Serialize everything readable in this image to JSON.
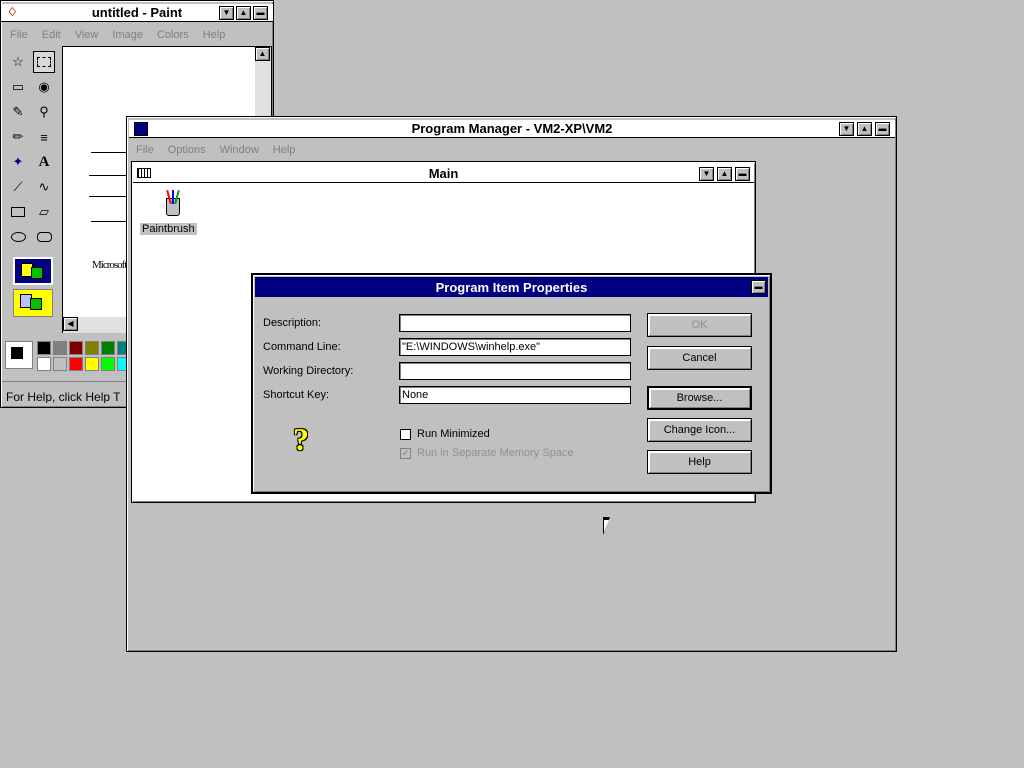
{
  "paint": {
    "title": "untitled - Paint",
    "menu": [
      "File",
      "Edit",
      "View",
      "Image",
      "Colors",
      "Help"
    ],
    "canvas_text": "Microsoft",
    "status": "For Help, click Help T",
    "palette": [
      "#000000",
      "#808080",
      "#800000",
      "#808000",
      "#008000",
      "#008080",
      "#ffffff",
      "#c0c0c0",
      "#ff0000",
      "#ffff00",
      "#00ff00",
      "#00ffff"
    ]
  },
  "progman": {
    "title": "Program Manager - VM2-XP\\VM2",
    "menu": [
      "File",
      "Options",
      "Window",
      "Help"
    ],
    "group": {
      "title": "Main",
      "icon_label": "Paintbrush"
    }
  },
  "dialog": {
    "title": "Program Item Properties",
    "labels": {
      "description": "Description:",
      "command": "Command Line:",
      "workdir": "Working Directory:",
      "shortcut": "Shortcut Key:"
    },
    "values": {
      "description": "",
      "command": "\"E:\\WINDOWS\\winhelp.exe\"",
      "workdir": "",
      "shortcut": "None"
    },
    "run_minimized": "Run Minimized",
    "run_separate": "Run in Separate Memory Space",
    "buttons": {
      "ok": "OK",
      "cancel": "Cancel",
      "browse": "Browse...",
      "change_icon": "Change Icon...",
      "help": "Help"
    }
  }
}
